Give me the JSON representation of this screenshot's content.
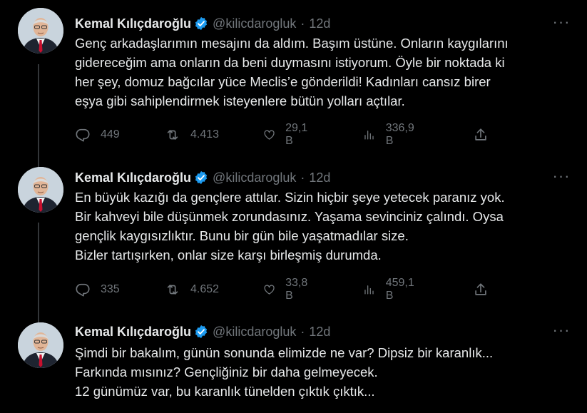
{
  "tweets": [
    {
      "author": {
        "name": "Kemal Kılıçdaroğlu",
        "handle": "@kilicdarogluk",
        "time": "12d"
      },
      "lines": [
        "Genç arkadaşlarımın mesajını da aldım. Başım üstüne. Onların kaygılarını",
        "gidereceğim ama onların da beni duymasını istiyorum. Öyle bir noktada ki",
        "her şey, domuz bağcılar yüce Meclis’e gönderildi! Kadınları cansız birer",
        "eşya gibi sahiplendirmek isteyenlere bütün yolları açtılar."
      ],
      "stats": {
        "replies": "449",
        "retweets": "4.413",
        "likes": "29,1 B",
        "views": "336,9 B"
      }
    },
    {
      "author": {
        "name": "Kemal Kılıçdaroğlu",
        "handle": "@kilicdarogluk",
        "time": "12d"
      },
      "lines": [
        "En büyük kazığı da gençlere attılar. Sizin hiçbir şeye yetecek paranız yok.",
        "Bir kahveyi bile düşünmek zorundasınız. Yaşama sevinciniz çalındı. Oysa",
        "gençlik kaygısızlıktır. Bunu bir gün bile yaşatmadılar size.",
        "Bizler tartışırken, onlar size karşı birleşmiş durumda."
      ],
      "stats": {
        "replies": "335",
        "retweets": "4.652",
        "likes": "33,8 B",
        "views": "459,1 B"
      }
    },
    {
      "author": {
        "name": "Kemal Kılıçdaroğlu",
        "handle": "@kilicdarogluk",
        "time": "12d"
      },
      "lines": [
        "Şimdi bir bakalım, günün sonunda elimizde ne var?  Dipsiz bir karanlık...",
        "Farkında mısınız? Gençliğiniz bir daha gelmeyecek.",
        "12 günümüz var, bu karanlık tünelden çıktık çıktık..."
      ]
    }
  ],
  "ui": {
    "separator": "·",
    "more_glyph": "···"
  },
  "icons": {
    "reply": "reply-icon",
    "retweet": "retweet-icon",
    "like": "heart-icon",
    "views": "views-icon",
    "share": "share-icon",
    "verified": "verified-badge-icon",
    "more": "more-icon"
  },
  "colors": {
    "background": "#000000",
    "text": "#e7e9ea",
    "muted": "#71767b",
    "verified": "#1d9bf0",
    "thread_line": "#333639"
  }
}
